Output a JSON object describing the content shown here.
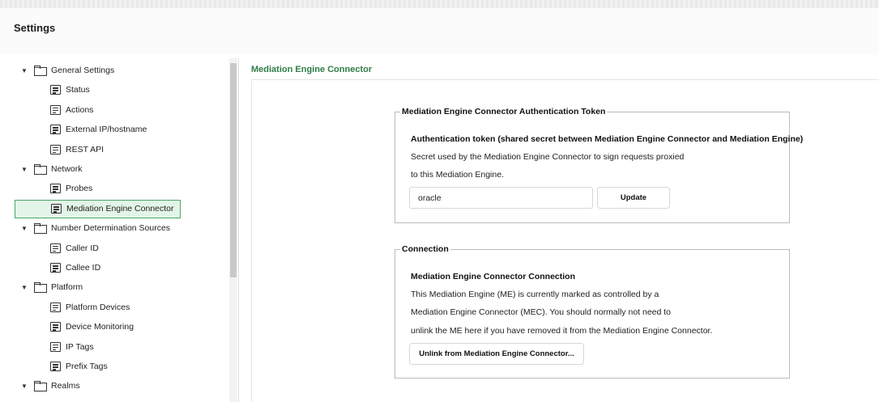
{
  "header": {
    "title": "Settings"
  },
  "sidebar": {
    "items": [
      {
        "type": "folder",
        "label": "General Settings",
        "name": "sidebar-folder-general-settings"
      },
      {
        "type": "page",
        "label": "Status",
        "name": "sidebar-item-status"
      },
      {
        "type": "page",
        "label": "Actions",
        "name": "sidebar-item-actions"
      },
      {
        "type": "page",
        "label": "External IP/hostname",
        "name": "sidebar-item-external-ip-hostname"
      },
      {
        "type": "page",
        "label": "REST API",
        "name": "sidebar-item-rest-api"
      },
      {
        "type": "folder",
        "label": "Network",
        "name": "sidebar-folder-network"
      },
      {
        "type": "page",
        "label": "Probes",
        "name": "sidebar-item-probes"
      },
      {
        "type": "page",
        "label": "Mediation Engine Connector",
        "name": "sidebar-item-mediation-engine-connector",
        "selected": true
      },
      {
        "type": "folder",
        "label": "Number Determination Sources",
        "name": "sidebar-folder-number-determination-sources"
      },
      {
        "type": "page",
        "label": "Caller ID",
        "name": "sidebar-item-caller-id"
      },
      {
        "type": "page",
        "label": "Callee ID",
        "name": "sidebar-item-callee-id"
      },
      {
        "type": "folder",
        "label": "Platform",
        "name": "sidebar-folder-platform"
      },
      {
        "type": "page",
        "label": "Platform Devices",
        "name": "sidebar-item-platform-devices"
      },
      {
        "type": "page",
        "label": "Device Monitoring",
        "name": "sidebar-item-device-monitoring"
      },
      {
        "type": "page",
        "label": "IP Tags",
        "name": "sidebar-item-ip-tags"
      },
      {
        "type": "page",
        "label": "Prefix Tags",
        "name": "sidebar-item-prefix-tags"
      },
      {
        "type": "folder",
        "label": "Realms",
        "name": "sidebar-folder-realms"
      }
    ]
  },
  "main": {
    "section_title": "Mediation Engine Connector",
    "auth": {
      "legend": "Mediation Engine Connector Authentication Token",
      "heading": "Authentication token (shared secret between Mediation Engine Connector and Mediation Engine)",
      "line1": "Secret used by the Mediation Engine Connector to sign requests proxied",
      "line2": "to this Mediation Engine.",
      "token_value": "oracle",
      "update_label": "Update"
    },
    "connection": {
      "legend": "Connection",
      "heading": "Mediation Engine Connector Connection",
      "line1": "This Mediation Engine (ME) is currently marked as controlled by a",
      "line2": "Mediation Engine Connector (MEC). You should normally not need to",
      "line3": "unlink the ME here if you have removed it from the Mediation Engine Connector.",
      "unlink_label": "Unlink from Mediation Engine Connector..."
    }
  },
  "colors": {
    "accent_green": "#2e7d46",
    "selected_bg": "#e3f5e8",
    "selected_border": "#4aa765"
  }
}
